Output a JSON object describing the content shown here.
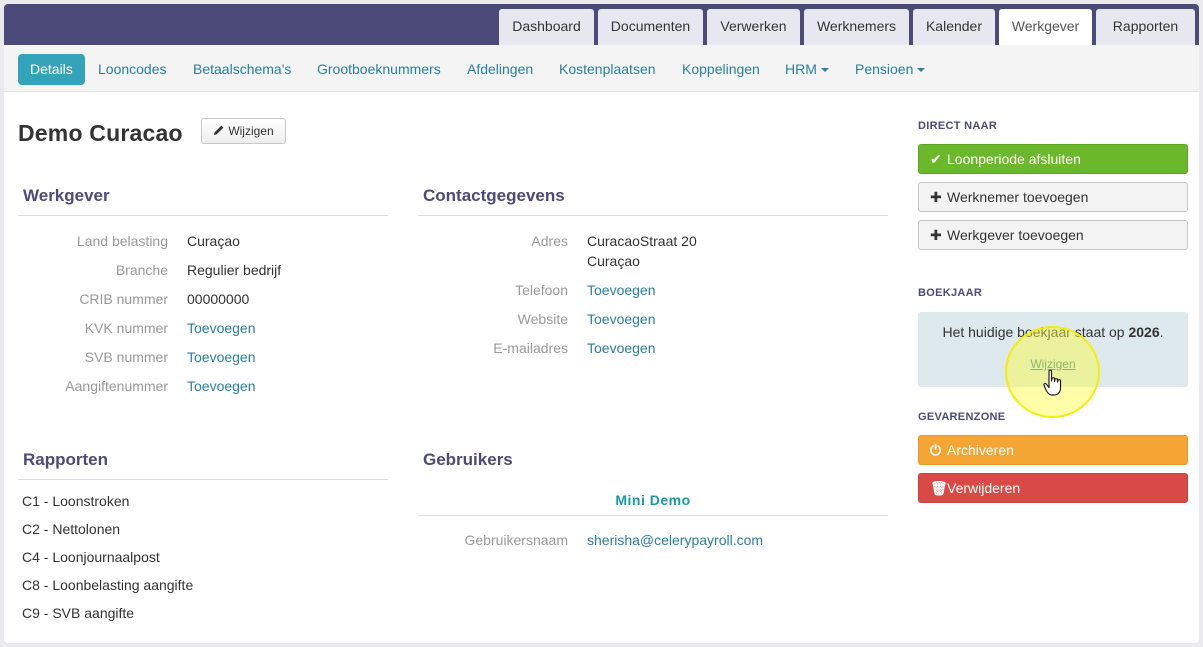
{
  "topnav": {
    "tabs": [
      {
        "label": "Dashboard",
        "active": false
      },
      {
        "label": "Documenten",
        "active": false
      },
      {
        "label": "Verwerken",
        "active": false
      },
      {
        "label": "Werknemers",
        "active": false
      },
      {
        "label": "Kalender",
        "active": false
      },
      {
        "label": "Werkgever",
        "active": true
      },
      {
        "label": "Rapporten",
        "active": false
      }
    ]
  },
  "subnav": {
    "items": [
      {
        "label": "Details",
        "active": true
      },
      {
        "label": "Looncodes"
      },
      {
        "label": "Betaalschema's"
      },
      {
        "label": "Grootboeknummers"
      },
      {
        "label": "Afdelingen"
      },
      {
        "label": "Kostenplaatsen"
      },
      {
        "label": "Koppelingen"
      },
      {
        "label": "HRM",
        "dropdown": true
      },
      {
        "label": "Pensioen",
        "dropdown": true
      }
    ]
  },
  "page": {
    "title": "Demo Curacao",
    "edit_label": "Wijzigen"
  },
  "werkgever": {
    "heading": "Werkgever",
    "rows": [
      {
        "label": "Land belasting",
        "value": "Curaçao"
      },
      {
        "label": "Branche",
        "value": "Regulier bedrijf"
      },
      {
        "label": "CRIB nummer",
        "value": "00000000"
      },
      {
        "label": "KVK nummer",
        "value": "Toevoegen"
      },
      {
        "label": "SVB nummer",
        "value": "Toevoegen"
      },
      {
        "label": "Aangiftenummer",
        "value": "Toevoegen"
      }
    ]
  },
  "contact": {
    "heading": "Contactgegevens",
    "address_label": "Adres",
    "address_line1": "CuracaoStraat 20",
    "address_line2": "Curaçao",
    "rows": [
      {
        "label": "Telefoon",
        "value": "Toevoegen"
      },
      {
        "label": "Website",
        "value": "Toevoegen"
      },
      {
        "label": "E-mailadres",
        "value": "Toevoegen"
      }
    ]
  },
  "rapporten": {
    "heading": "Rapporten",
    "items": [
      "C1 - Loonstroken",
      "C2 - Nettolonen",
      "C4 - Loonjournaalpost",
      "C8 - Loonbelasting aangifte",
      "C9 - SVB aangifte"
    ]
  },
  "gebruikers": {
    "heading": "Gebruikers",
    "user_name": "Mini Demo",
    "username_label": "Gebruikersnaam",
    "username_value": "sherisha@celerypayroll.com"
  },
  "sidebar": {
    "direct_heading": "DIRECT NAAR",
    "btn_close_period": "Loonperiode afsluiten",
    "btn_add_employee": "Werknemer toevoegen",
    "btn_add_employer": "Werkgever toevoegen",
    "boekjaar_heading": "BOEKJAAR",
    "boekjaar_text": "Het huidige boekjaar staat op",
    "boekjaar_year": "2026",
    "boekjaar_dot": ".",
    "boekjaar_change": "Wijzigen",
    "danger_heading": "GEVARENZONE",
    "btn_archive": "Archiveren",
    "btn_delete": "Verwijderen"
  },
  "colors": {
    "nav_bg": "#4c4a78",
    "accent": "#33a3b9",
    "link": "#2b7f9e",
    "green": "#6bb82a",
    "orange": "#f5a533",
    "red": "#d94a47"
  }
}
